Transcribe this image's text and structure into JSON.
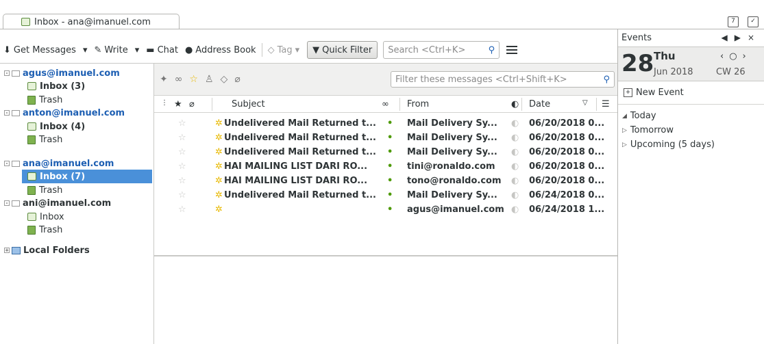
{
  "tab": {
    "label": "Inbox - ana@imanuel.com"
  },
  "toolbar": {
    "get_messages": "Get Messages",
    "write": "Write",
    "chat": "Chat",
    "address_book": "Address Book",
    "tag": "Tag",
    "quick_filter": "Quick Filter",
    "search_placeholder": "Search <Ctrl+K>"
  },
  "folders": {
    "accounts": [
      {
        "name": "agus@imanuel.com",
        "inbox": "Inbox (3)",
        "trash": "Trash"
      },
      {
        "name": "anton@imanuel.com",
        "inbox": "Inbox (4)",
        "trash": "Trash"
      },
      {
        "name": "ana@imanuel.com",
        "inbox": "Inbox (7)",
        "trash": "Trash"
      },
      {
        "name": "ani@imanuel.com",
        "inbox": "Inbox",
        "trash": "Trash"
      }
    ],
    "local": "Local Folders"
  },
  "filter": {
    "placeholder": "Filter these messages <Ctrl+Shift+K>"
  },
  "columns": {
    "subject": "Subject",
    "from": "From",
    "date": "Date"
  },
  "messages": [
    {
      "subject": "Undelivered Mail Returned t...",
      "from": "Mail Delivery Sy...",
      "date": "06/20/2018 0..."
    },
    {
      "subject": "Undelivered Mail Returned t...",
      "from": "Mail Delivery Sy...",
      "date": "06/20/2018 0..."
    },
    {
      "subject": "Undelivered Mail Returned t...",
      "from": "Mail Delivery Sy...",
      "date": "06/20/2018 0..."
    },
    {
      "subject": "HAI MAILING LIST DARI RO...",
      "from": "tini@ronaldo.com",
      "date": "06/20/2018 0..."
    },
    {
      "subject": "HAI MAILING LIST DARI RO...",
      "from": "tono@ronaldo.com",
      "date": "06/20/2018 0..."
    },
    {
      "subject": "Undelivered Mail Returned t...",
      "from": "Mail Delivery Sy...",
      "date": "06/24/2018 0..."
    },
    {
      "subject": "",
      "from": "agus@imanuel.com",
      "date": "06/24/2018 1..."
    }
  ],
  "events": {
    "title": "Events",
    "day": "28",
    "weekday": "Thu",
    "month_year": "Jun 2018",
    "cw": "CW 26",
    "new_event": "New Event",
    "today": "Today",
    "tomorrow": "Tomorrow",
    "upcoming": "Upcoming (5 days)"
  }
}
